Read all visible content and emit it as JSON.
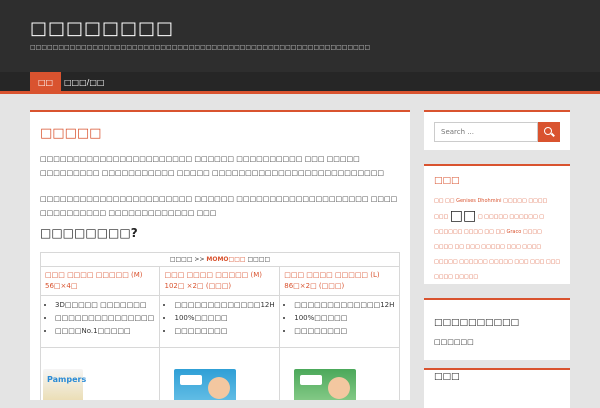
{
  "site": {
    "title": "□□□□□□□□",
    "description": "□□□□□□□□□□□□□□□□□□□□□□□□□□□□□□□□□□□□□□□□□□□□□□□□□□□□□□□□□□□□"
  },
  "nav": {
    "items": [
      {
        "label": "□□"
      },
      {
        "label": "□□□/□□"
      }
    ]
  },
  "post": {
    "title": "□□□□□",
    "para1": "□□□□□□□□□□□□□□□□□□□□□□□ □□□□□□ □□□□□□□□□□ □□□ □□□□□ □□□□□□□□□ □□□□□□□□□□□ □□□□□ □□□□□□□□□□□□□□□□□□□□□□□□□□",
    "para2": "□□□□□□□□□□□□□□□□□□□□□□□ □□□□□□ □□□□□□□□□□□□□□□□□□□□ □□□□ □□□□□□□□□□ □□□□□□□□□□□□□ □□□",
    "section_heading": "□□□□□□□□?",
    "table": {
      "caption_prefix": "□□□□ >>",
      "caption_highlight": "MOMO□□□",
      "caption_suffix": "□□□□",
      "products": [
        {
          "name": "□□□ □□□□ □□□□□ (M) 56□×4□"
        },
        {
          "name": "□□□ □□□□ □□□□□ (M) 102□ ×2□ (□□□)"
        },
        {
          "name": "□□□ □□□□ □□□□□ (L) 86□×2□ (□□□)"
        }
      ],
      "features": [
        [
          "3D□□□□□ □□□□□□□",
          "□□□□□□□□□□□□□□□",
          "□□□□No.1□□□□□"
        ],
        [
          "□□□□□□□□□□□□□12H",
          "100%□□□□□",
          "□□□□□□□□"
        ],
        [
          "□□□□□□□□□□□□□12H",
          "100%□□□□□",
          "□□□□□□□□"
        ]
      ],
      "image_labels": [
        "Pampers",
        "",
        ""
      ]
    }
  },
  "sidebar": {
    "search_placeholder": "Search ...",
    "tags_title": "□□□",
    "tags_text_a": "□□ □□ Genises Dhohmini □□□□□ □□□□ □□□",
    "tags_big": "□□",
    "tags_text_b": "□ □□□□□ □□□□□□ □ □□□□□□ □□□□ □□ □□ Graco □□□□ □□□□ □□ □□□ □□□□□ □□□ □□□□ □□□□□ □□□□□□ □□□□□ □□□ □□□ □□□ □□□□ □□□□□",
    "recent_title": "□□□□□□□□□□",
    "recent_item": "□□□□□□",
    "bottom_title": "□□□"
  }
}
